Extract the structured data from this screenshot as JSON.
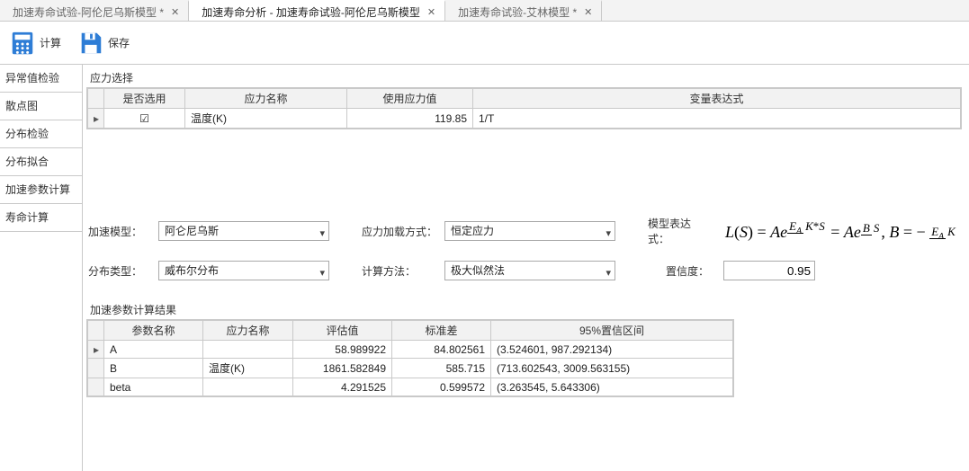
{
  "tabs": [
    {
      "label": "加速寿命试验-阿伦尼乌斯模型 *"
    },
    {
      "label": "加速寿命分析 - 加速寿命试验-阿伦尼乌斯模型"
    },
    {
      "label": "加速寿命试验-艾林模型 *"
    }
  ],
  "toolbar": {
    "calc_label": "计算",
    "save_label": "保存"
  },
  "sidebar": {
    "items": [
      "异常值检验",
      "散点图",
      "分布检验",
      "分布拟合",
      "加速参数计算",
      "寿命计算"
    ]
  },
  "stress": {
    "section_title": "应力选择",
    "headers": [
      "是否选用",
      "应力名称",
      "使用应力值",
      "变量表达式"
    ],
    "row": {
      "selected": true,
      "name": "温度(K)",
      "use_value": "119.85",
      "expr": "1/T"
    }
  },
  "params": {
    "model_label": "加速模型：",
    "model_value": "阿仑尼乌斯",
    "load_label": "应力加载方式：",
    "load_value": "恒定应力",
    "formula_label": "模型表达式：",
    "dist_label": "分布类型：",
    "dist_value": "威布尔分布",
    "method_label": "计算方法：",
    "method_value": "极大似然法",
    "conf_label": "置信度：",
    "conf_value": "0.95"
  },
  "results": {
    "section_title": "加速参数计算结果",
    "headers": [
      "参数名称",
      "应力名称",
      "评估值",
      "标准差",
      "95%置信区间"
    ],
    "rows": [
      {
        "name": "A",
        "stress": "",
        "est": "58.989922",
        "sd": "84.802561",
        "ci": "(3.524601, 987.292134)"
      },
      {
        "name": "B",
        "stress": "温度(K)",
        "est": "1861.582849",
        "sd": "585.715",
        "ci": "(713.602543, 3009.563155)"
      },
      {
        "name": "beta",
        "stress": "",
        "est": "4.291525",
        "sd": "0.599572",
        "ci": "(3.263545, 5.643306)"
      }
    ]
  }
}
